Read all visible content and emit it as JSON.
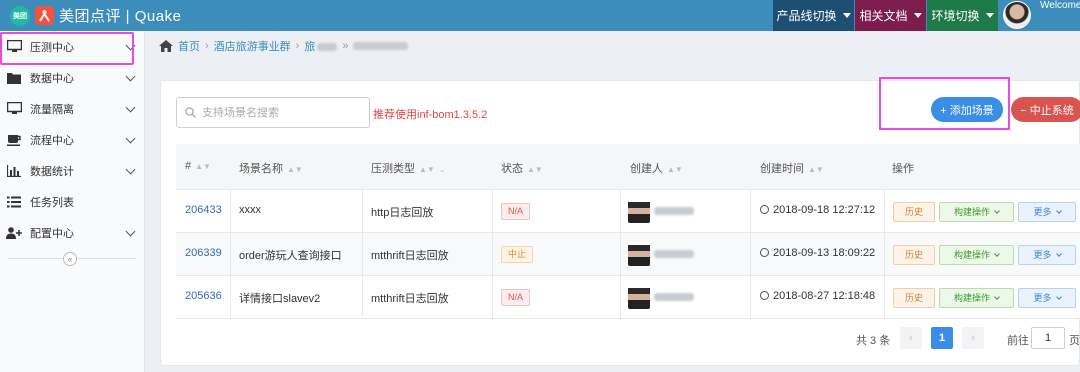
{
  "header": {
    "brand_badge": "美团",
    "brand_name": "美团点评 | Quake",
    "nav": [
      {
        "label": "产品线切换",
        "color": "#1d4f72"
      },
      {
        "label": "相关文档",
        "color": "#7d1d4e"
      },
      {
        "label": "环境切换",
        "color": "#1f7a4a"
      }
    ],
    "welcome": "Welcome"
  },
  "sidebar": {
    "items": [
      {
        "label": "压测中心",
        "icon": "monitor-icon",
        "has_children": true,
        "highlighted": true
      },
      {
        "label": "数据中心",
        "icon": "folder-icon",
        "has_children": true
      },
      {
        "label": "流量隔离",
        "icon": "monitor-icon",
        "has_children": true
      },
      {
        "label": "流程中心",
        "icon": "coffee-icon",
        "has_children": true
      },
      {
        "label": "数据统计",
        "icon": "bar-chart-icon",
        "has_children": true
      },
      {
        "label": "任务列表",
        "icon": "list-icon",
        "has_children": false
      },
      {
        "label": "配置中心",
        "icon": "user-plus-icon",
        "has_children": true
      }
    ],
    "collapse_glyph": "«"
  },
  "breadcrumb": {
    "home": "首页",
    "level1": "酒店旅游事业群",
    "level2": "旅"
  },
  "toolbar": {
    "search_placeholder": "支持场景名搜索",
    "hint": "推荐使用inf-bom1.3.5.2",
    "add_label": "+ 添加场景",
    "stop_label": "− 中止系统"
  },
  "table": {
    "columns": [
      "#",
      "场景名称",
      "压测类型",
      "状态",
      "创建人",
      "创建时间",
      "操作"
    ],
    "rows": [
      {
        "id": "206433",
        "name": "xxxx",
        "type": "http日志回放",
        "status": "N/A",
        "status_kind": "na",
        "time": "2018-09-18 12:27:12"
      },
      {
        "id": "206339",
        "name": "order游玩人查询接口",
        "type": "mtthrift日志回放",
        "status": "中止",
        "status_kind": "stop",
        "time": "2018-09-13 18:09:22"
      },
      {
        "id": "205636",
        "name": "详情接口slavev2",
        "type": "mtthrift日志回放",
        "status": "N/A",
        "status_kind": "na",
        "time": "2018-08-27 12:18:48"
      }
    ],
    "actions": {
      "history": "历史",
      "build": "构建操作",
      "more": "更多"
    }
  },
  "pagination": {
    "total": "共 3 条",
    "prev": "‹",
    "current": "1",
    "next": "›",
    "goto_label": "前往",
    "goto_value": "1",
    "page_unit": "页"
  },
  "colors": {
    "topbar": "#3c8dbc",
    "accent": "#3a8ee6",
    "danger": "#d9534f",
    "highlight_annotation": "#e64ddc"
  }
}
